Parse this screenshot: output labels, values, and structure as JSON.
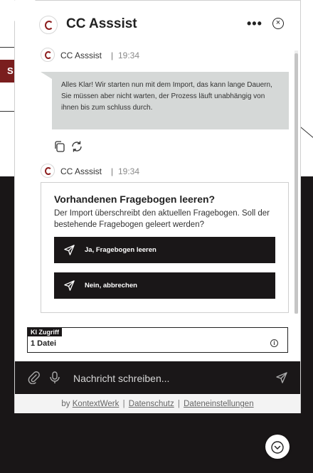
{
  "background": {
    "red_tab_letter": "S"
  },
  "header": {
    "title": "CC Asssist",
    "menu_icon": "more-horizontal-icon",
    "close_icon": "close-circle-icon"
  },
  "messages": [
    {
      "sender": "CC Asssist",
      "time": "19:34",
      "text": "Alles Klar! Wir starten nun mit dem Import, das kann lange Dauern, Sie müssen aber nicht warten, der Prozess läuft unabhängig von ihnen bis zum schluss durch.",
      "actions": [
        "copy-icon",
        "refresh-icon"
      ]
    },
    {
      "sender": "CC Asssist",
      "time": "19:34",
      "card": {
        "title": "Vorhandenen Fragebogen leeren?",
        "text": "Der Import überschreibt den aktuellen Fragebogen. Soll der bestehende Fragebogen geleert werden?",
        "buttons": [
          {
            "label": "Ja, Fragebogen leeren",
            "icon": "send-icon"
          },
          {
            "label": "Nein, abbrechen",
            "icon": "send-icon"
          }
        ]
      }
    }
  ],
  "context": {
    "tag": "KI Zugriff",
    "count": "1 Datei"
  },
  "composer": {
    "placeholder": "Nachricht schreiben..."
  },
  "footer": {
    "prefix": "by",
    "brand": "KontextWerk",
    "privacy": "Datenschutz",
    "file_settings": "Dateneinstellungen",
    "separator": "|"
  },
  "colors": {
    "brand_red": "#8c1c1c",
    "dark": "#1a1718",
    "bubble": "#d5d8d7"
  }
}
